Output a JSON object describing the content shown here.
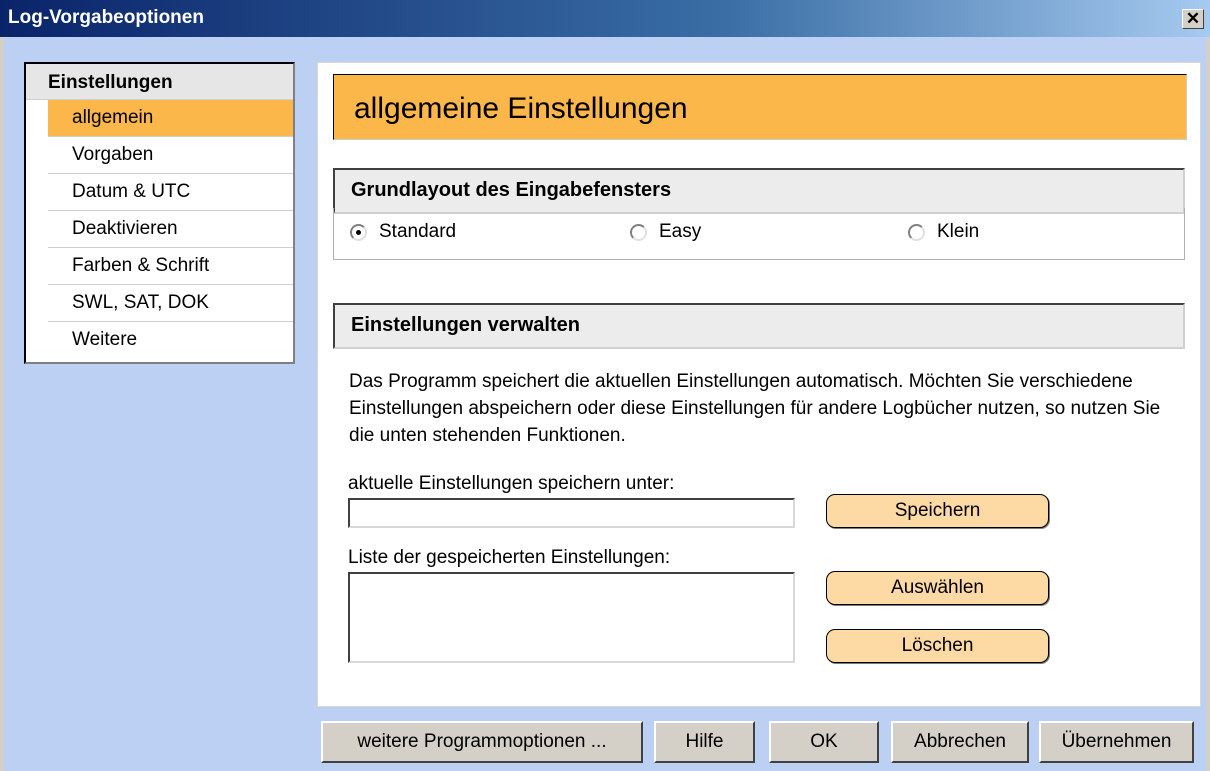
{
  "window": {
    "title": "Log-Vorgabeoptionen",
    "close_glyph": "✕"
  },
  "nav": {
    "header": "Einstellungen",
    "items": [
      {
        "label": "allgemein",
        "active": true
      },
      {
        "label": "Vorgaben"
      },
      {
        "label": "Datum & UTC"
      },
      {
        "label": "Deaktivieren"
      },
      {
        "label": "Farben & Schrift"
      },
      {
        "label": "SWL, SAT, DOK"
      },
      {
        "label": "Weitere"
      }
    ]
  },
  "page": {
    "title": "allgemeine Einstellungen"
  },
  "layout_group": {
    "title": "Grundlayout des Eingabefensters",
    "options": [
      {
        "label": "Standard",
        "selected": true
      },
      {
        "label": "Easy",
        "selected": false
      },
      {
        "label": "Klein",
        "selected": false
      }
    ]
  },
  "manage_group": {
    "title": "Einstellungen verwalten",
    "description": "Das Programm speichert die aktuellen Einstellungen  automatisch. Möchten Sie verschiedene Einstellungen abspeichern oder diese Einstellungen für andere Logbücher nutzen, so nutzen Sie die unten stehenden Funktionen.",
    "save_label": "aktuelle Einstellungen speichern unter:",
    "save_value": "",
    "list_label": "Liste der gespeicherten Einstellungen:",
    "saved_items": [],
    "save_button": "Speichern",
    "select_button": "Auswählen",
    "delete_button": "Löschen"
  },
  "footer": {
    "more_options": "weitere Programmoptionen ...",
    "help": "Hilfe",
    "ok": "OK",
    "cancel": "Abbrechen",
    "apply": "Übernehmen"
  },
  "colors": {
    "accent": "#fbb74a",
    "pill": "#fdd9a3",
    "background": "#bcd0f4",
    "titlebar": "#0a246a"
  }
}
